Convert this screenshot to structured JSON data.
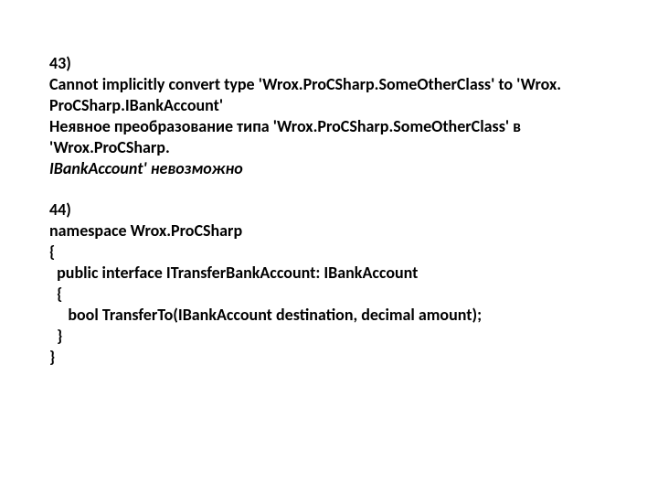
{
  "item43": {
    "num": "43)",
    "err_line1": "Cannot implicitly convert type 'Wrox.ProCSharp.SomeOtherClass' to 'Wrox.",
    "err_line2": "ProCSharp.IBankAccount'",
    "ru_line1_a": "Неявное преобразование типа ",
    "ru_line1_b": "'Wrox.ProCSharp.SomeOtherClass' ",
    "ru_line1_c": "в",
    "ru_line2": "'Wrox.ProCSharp.",
    "ru_line3_a": "IBankAccount' ",
    "ru_line3_b": "невозможно"
  },
  "item44": {
    "num": "44)",
    "c1": "namespace Wrox.ProCSharp",
    "c2": "{",
    "c3": "  public interface ITransferBankAccount: IBankAccount",
    "c4": "  {",
    "c5": "     bool TransferTo(IBankAccount destination, decimal amount);",
    "c6": "  }",
    "c7": "}"
  }
}
